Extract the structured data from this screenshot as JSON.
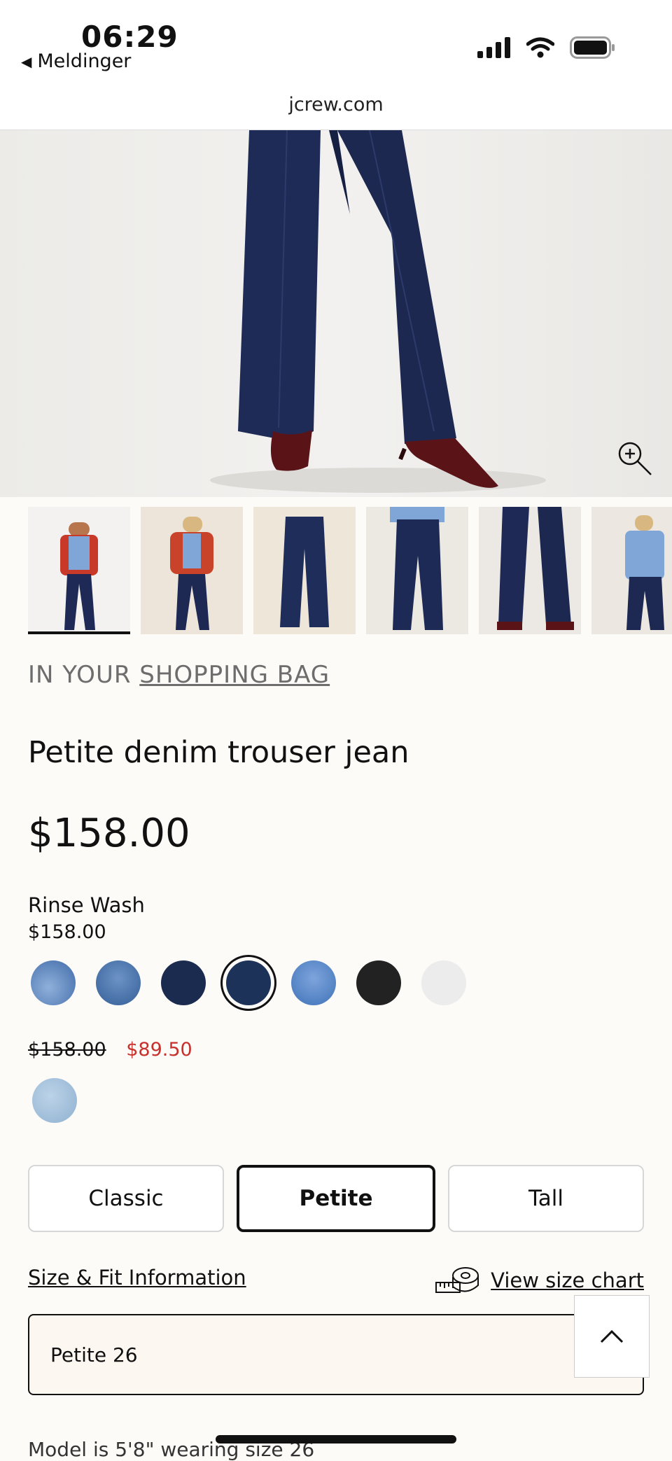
{
  "status": {
    "time": "06:29",
    "back_label": "Meldinger"
  },
  "browser": {
    "url": "jcrew.com"
  },
  "icons": {
    "zoom": "zoom-in-icon",
    "back": "back-triangle-icon",
    "signal": "signal-icon",
    "wifi": "wifi-icon",
    "battery": "battery-icon",
    "tape": "measuring-tape-icon",
    "chevron": "chevron-up-icon"
  },
  "bag": {
    "prefix": "IN YOUR",
    "link": "SHOPPING BAG"
  },
  "product": {
    "name": "Petite denim trouser jean",
    "price": "$158.00"
  },
  "color": {
    "selected_name": "Rinse Wash",
    "selected_price": "$158.00"
  },
  "swatches": [
    "#4f79b3",
    "#3d6ca5",
    "#1b2a4f",
    "#1d3258",
    "#4a7bc0",
    "#222222",
    "#ececec"
  ],
  "sale": {
    "old_price": "$158.00",
    "new_price": "$89.50"
  },
  "fit": {
    "options": [
      "Classic",
      "Petite",
      "Tall"
    ],
    "selected": "Petite"
  },
  "links": {
    "size_fit": "Size & Fit Information",
    "size_chart": "View size chart"
  },
  "size": {
    "selected": "Petite 26"
  },
  "model_info": "Model is 5'8\" wearing size 26",
  "colors": {
    "accent": "#111111",
    "sale": "#c8302c"
  }
}
